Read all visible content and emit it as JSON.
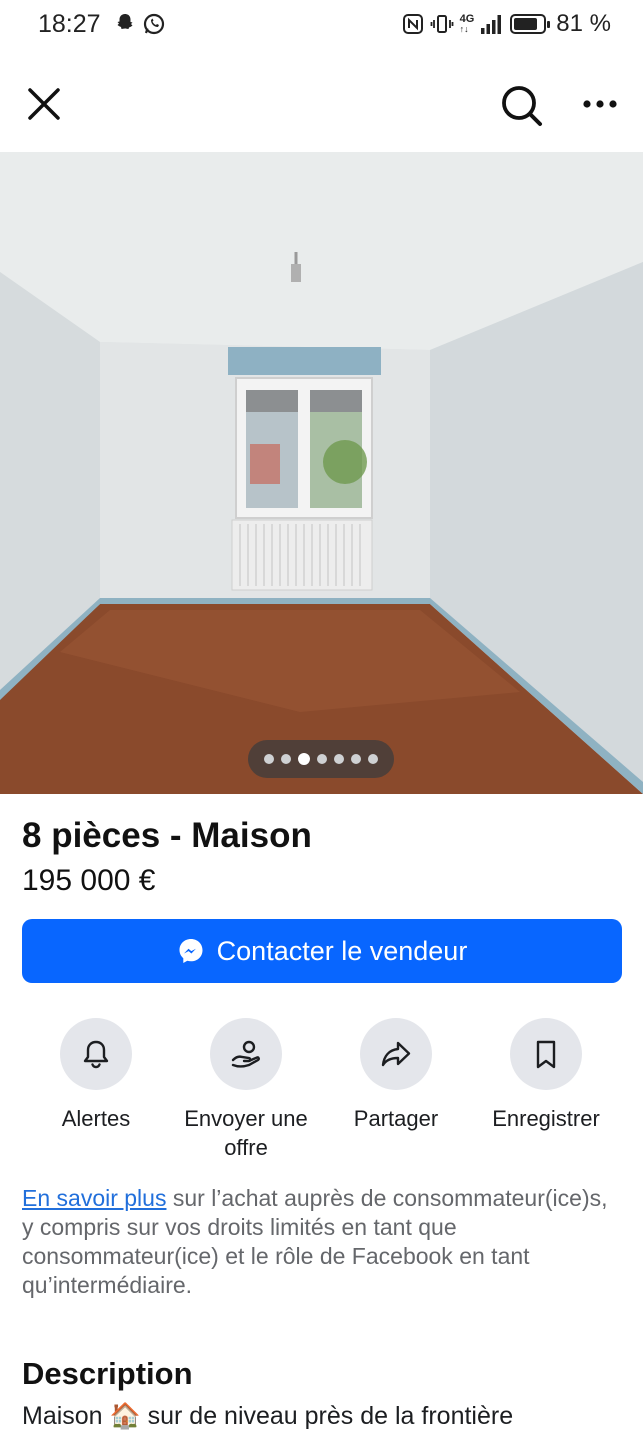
{
  "status_bar": {
    "time": "18:27",
    "battery": "81 %",
    "battery_level": 0.81,
    "icons": [
      "snapchat-icon",
      "whatsapp-icon",
      "nfc-icon",
      "vibrate-icon",
      "4g-icon",
      "signal-icon",
      "battery-icon"
    ],
    "network": "4G"
  },
  "top_bar": {
    "icons": [
      "close-icon",
      "search-icon",
      "more-icon"
    ]
  },
  "photo": {
    "image_count": 7,
    "active_index": 2
  },
  "listing": {
    "title": "8 pièces - Maison",
    "price": "195 000 €",
    "contact_label": "Contacter le vendeur"
  },
  "actions": [
    {
      "label": "Alertes",
      "icon": "bell-icon"
    },
    {
      "label": "Envoyer une offre",
      "icon": "offer-icon"
    },
    {
      "label": "Partager",
      "icon": "share-icon"
    },
    {
      "label": "Enregistrer",
      "icon": "bookmark-icon"
    }
  ],
  "info": {
    "link": "En savoir plus",
    "text": " sur l’achat auprès de consommateur(ice)s, y compris sur vos droits limités en tant que consommateur(ice) et le rôle de Facebook en tant qu’intermédiaire."
  },
  "description": {
    "heading": "Description",
    "text": "Maison 🏠 sur de niveau près de la frontière"
  },
  "colors": {
    "accent": "#0866ff",
    "link": "#216fdb",
    "action_bg": "#e4e6eb"
  }
}
